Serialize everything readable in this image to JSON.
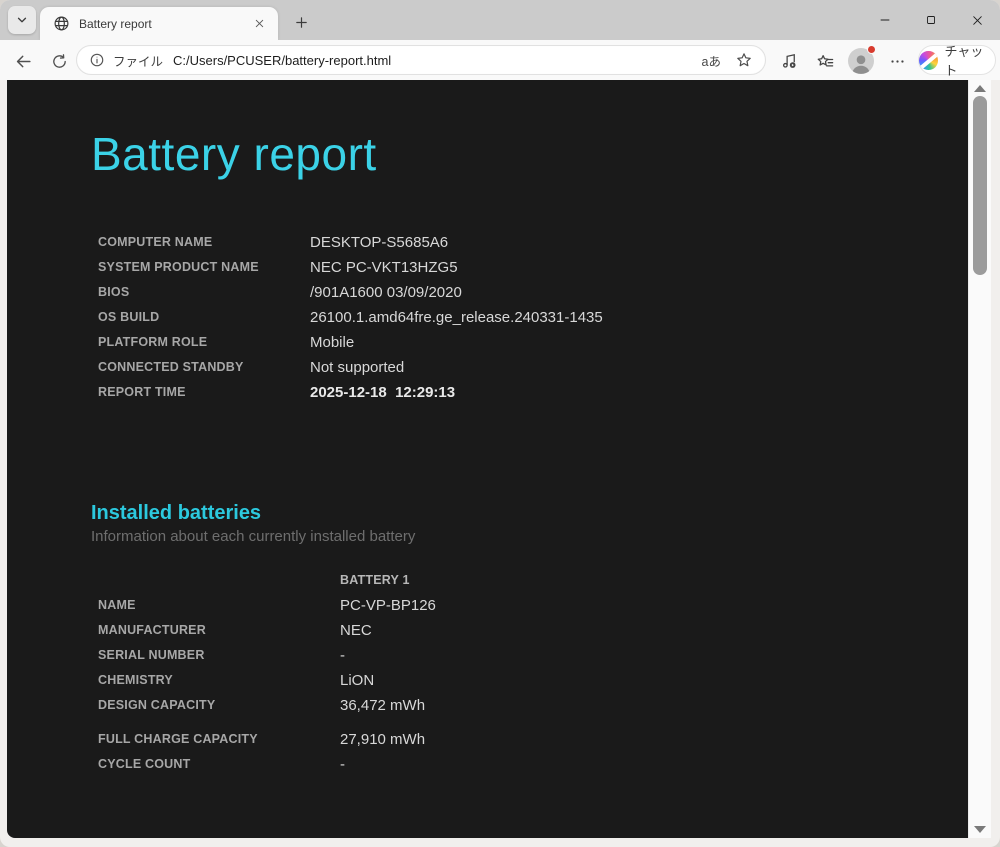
{
  "browser": {
    "tab_title": "Battery report",
    "new_tab_hint": "+",
    "address": {
      "scheme_label": "ファイル",
      "url": "C:/Users/PCUSER/battery-report.html",
      "lang_toggle": "aあ"
    },
    "copilot_label": "チャット"
  },
  "report": {
    "title": "Battery report",
    "system": [
      {
        "label": "COMPUTER NAME",
        "value": "DESKTOP-S5685A6"
      },
      {
        "label": "SYSTEM PRODUCT NAME",
        "value": "NEC PC-VKT13HZG5"
      },
      {
        "label": "BIOS",
        "value": "/901A1600 03/09/2020"
      },
      {
        "label": "OS BUILD",
        "value": "26100.1.amd64fre.ge_release.240331-1435"
      },
      {
        "label": "PLATFORM ROLE",
        "value": "Mobile"
      },
      {
        "label": "CONNECTED STANDBY",
        "value": "Not supported"
      },
      {
        "label": "REPORT TIME",
        "value": "2025-12-18  12:29:13"
      }
    ],
    "installed_batteries": {
      "heading": "Installed batteries",
      "subtitle": "Information about each currently installed battery",
      "column_header": "BATTERY 1",
      "rows": [
        {
          "label": "NAME",
          "value": "PC-VP-BP126"
        },
        {
          "label": "MANUFACTURER",
          "value": "NEC"
        },
        {
          "label": "SERIAL NUMBER",
          "value": "-"
        },
        {
          "label": "CHEMISTRY",
          "value": "LiON"
        },
        {
          "label": "DESIGN CAPACITY",
          "value": "36,472 mWh"
        },
        {
          "label": "FULL CHARGE CAPACITY",
          "value": "27,910 mWh"
        },
        {
          "label": "CYCLE COUNT",
          "value": "-"
        }
      ]
    }
  },
  "colors": {
    "accent_cyan": "#3bd2e7",
    "heading_cyan": "#2cc9de",
    "page_background": "#1a1a1a",
    "chrome_background": "#f9f9f9",
    "tabstrip_background": "#cbcbcb"
  }
}
